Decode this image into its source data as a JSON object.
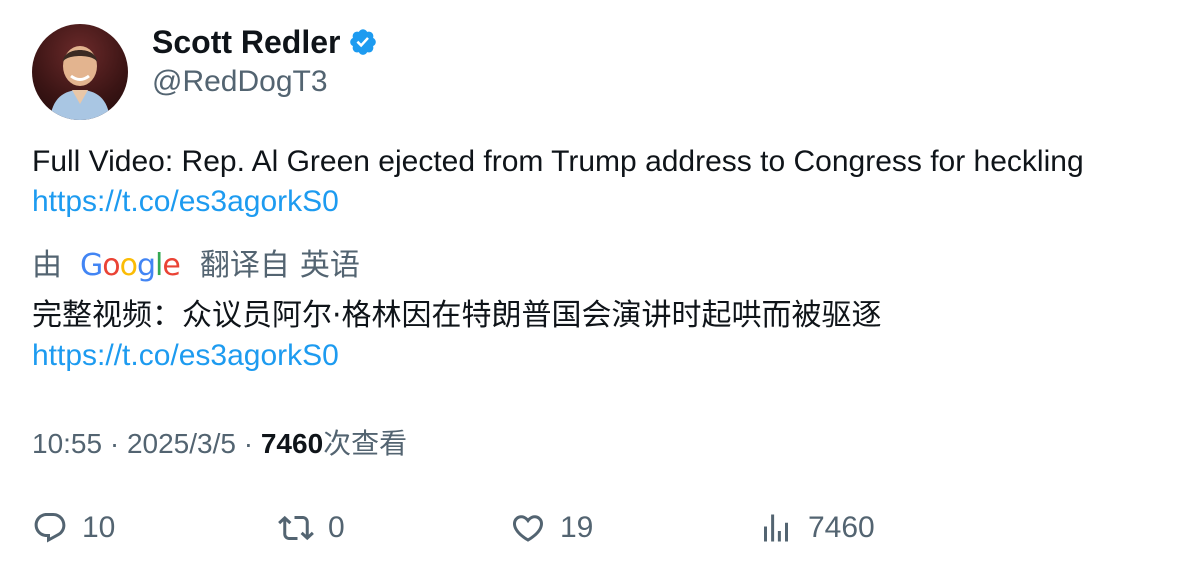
{
  "author": {
    "display_name": "Scott Redler",
    "handle": "@RedDogT3",
    "verified_icon": "verified-badge-icon",
    "badge_color": "#1d9bf0"
  },
  "tweet": {
    "text": "Full Video: Rep. Al Green ejected from Trump address to Congress for heckling",
    "link": "https://t.co/es3agorkS0"
  },
  "translation": {
    "prefix": "由",
    "provider": "Google",
    "label_1": "翻译自",
    "label_2": "英语",
    "text": "完整视频：众议员阿尔·格林因在特朗普国会演讲时起哄而被驱逐",
    "link": "https://t.co/es3agorkS0"
  },
  "meta": {
    "time": "10:55",
    "separator": "·",
    "date": "2025/3/5",
    "views_count": "7460",
    "views_label": "次查看"
  },
  "actions": {
    "reply_count": "10",
    "retweet_count": "0",
    "like_count": "19",
    "views_count": "7460"
  },
  "colors": {
    "link": "#1d9bf0",
    "secondary_text": "#536471",
    "primary_text": "#0f1419"
  }
}
